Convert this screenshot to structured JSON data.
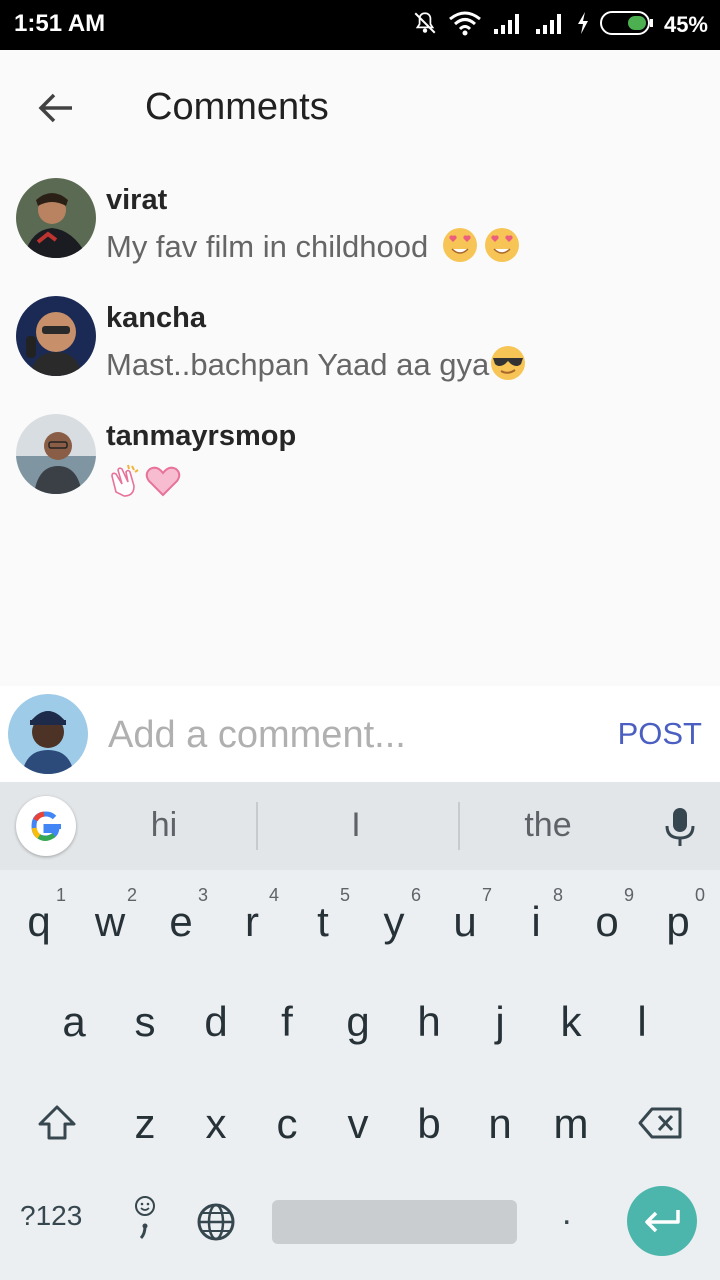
{
  "status": {
    "time": "1:51 AM",
    "battery": "45%"
  },
  "header": {
    "title": "Comments"
  },
  "comments": [
    {
      "user": "virat",
      "text": "My fav film in childhood",
      "emojis": [
        "smiling-heart-eyes",
        "smiling-heart-eyes"
      ]
    },
    {
      "user": "kancha",
      "text": "Mast..bachpan Yaad aa gya",
      "emojis": [
        "sunglasses-face"
      ]
    },
    {
      "user": "tanmayrsmop",
      "text": "",
      "emojis": [
        "clapping-hands",
        "pink-heart"
      ]
    }
  ],
  "composer": {
    "placeholder": "Add a comment...",
    "post_label": "POST"
  },
  "keyboard": {
    "suggestions": [
      "hi",
      "I",
      "the"
    ],
    "row1": [
      "q",
      "w",
      "e",
      "r",
      "t",
      "y",
      "u",
      "i",
      "o",
      "p"
    ],
    "row1_hints": [
      "1",
      "2",
      "3",
      "4",
      "5",
      "6",
      "7",
      "8",
      "9",
      "0"
    ],
    "row2": [
      "a",
      "s",
      "d",
      "f",
      "g",
      "h",
      "j",
      "k",
      "l"
    ],
    "row3": [
      "z",
      "x",
      "c",
      "v",
      "b",
      "n",
      "m"
    ],
    "symbols_label": "?123",
    "period_label": "."
  },
  "colors": {
    "accent": "#4a5fc1",
    "enter": "#4db6ac"
  }
}
